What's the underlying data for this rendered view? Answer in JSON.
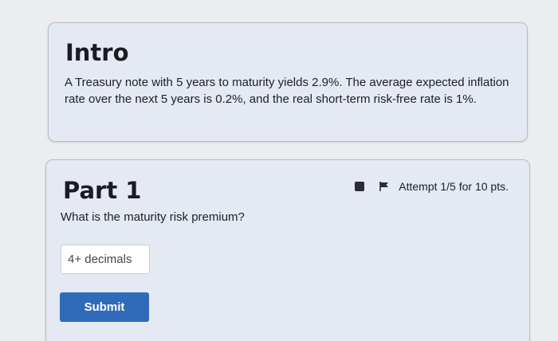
{
  "intro": {
    "title": "Intro",
    "text": "A Treasury note with 5 years to maturity yields 2.9%. The average expected inflation rate over the next 5 years is 0.2%, and the real short-term risk-free rate is 1%."
  },
  "part1": {
    "title": "Part 1",
    "attempt_text": "Attempt 1/5 for 10 pts.",
    "question": "What is the maturity risk premium?",
    "input": {
      "value": "",
      "placeholder": "4+ decimals"
    },
    "submit_label": "Submit"
  },
  "icons": {
    "status": "square-icon",
    "flag": "flag-icon"
  },
  "colors": {
    "accent": "#2f6bb8",
    "card_bg": "#e4e9f3"
  }
}
